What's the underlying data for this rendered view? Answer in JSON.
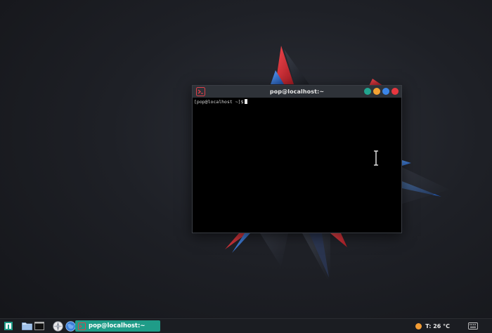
{
  "terminal": {
    "title": "pop@localhost:~",
    "prompt": "[pop@localhost ~]$"
  },
  "window_buttons": [
    {
      "name": "teal-button",
      "color": "#22a58f"
    },
    {
      "name": "minimize-button",
      "color": "#f3a233"
    },
    {
      "name": "maximize-button",
      "color": "#3b86e8"
    },
    {
      "name": "close-button",
      "color": "#e8373f"
    }
  ],
  "taskbar": {
    "task_label": "pop@localhost:~",
    "weather": "T: 26 °C",
    "icons": [
      "app-menu-icon",
      "files-icon",
      "terminal-icon",
      "browser-icon",
      "globe-icon"
    ]
  },
  "colors": {
    "accent": "#1f9c88",
    "wallpaper_red": "#e8303a",
    "wallpaper_blue": "#3b7fe0"
  }
}
